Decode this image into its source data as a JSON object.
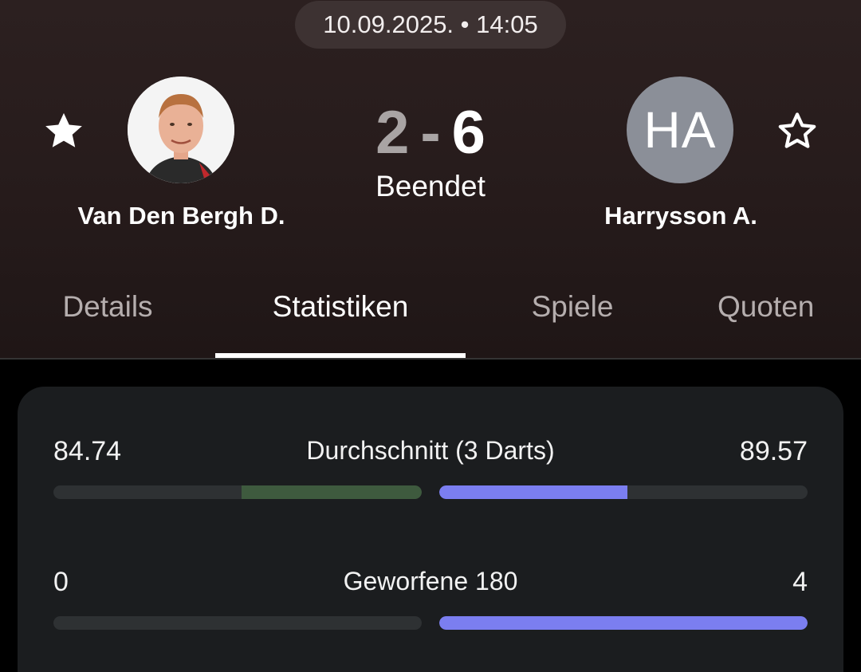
{
  "match": {
    "datetime": "10.09.2025. • 14:05",
    "status": "Beendet",
    "score_home": "2",
    "score_separator": "-",
    "score_away": "6"
  },
  "home": {
    "name": "Van Den Bergh D.",
    "favorite_icon": "star-filled-icon"
  },
  "away": {
    "name": "Harrysson A.",
    "initials": "HA",
    "favorite_icon": "star-outline-icon"
  },
  "tabs": [
    {
      "label": "Details",
      "active": false
    },
    {
      "label": "Statistiken",
      "active": true
    },
    {
      "label": "Spiele",
      "active": false
    },
    {
      "label": "Quoten",
      "active": false
    }
  ],
  "stats": [
    {
      "label": "Durchschnitt (3 Darts)",
      "home": "84.74",
      "away": "89.57",
      "home_fill": 0.49,
      "away_fill": 0.51
    },
    {
      "label": "Geworfene 180",
      "home": "0",
      "away": "4",
      "home_fill": 0.0,
      "away_fill": 1.0
    }
  ],
  "colors": {
    "home_bar": "#3e5a3e",
    "away_bar": "#7b7ef0",
    "card_bg": "#1b1d1f"
  }
}
